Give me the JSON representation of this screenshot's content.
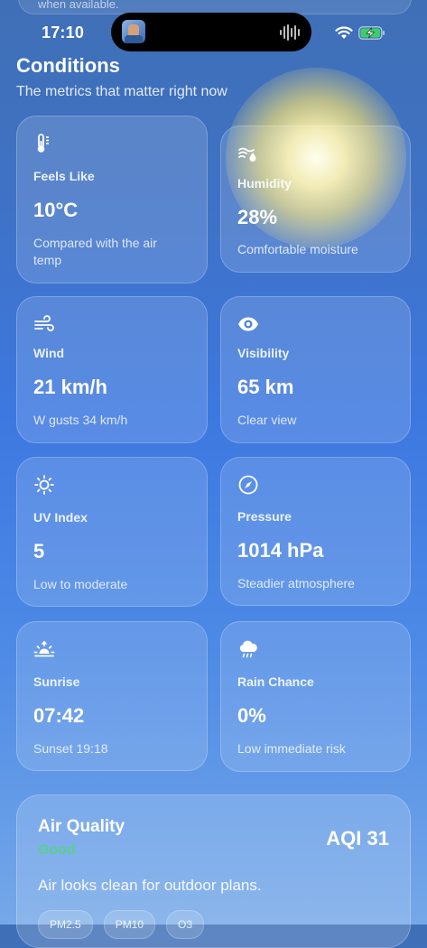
{
  "status_bar": {
    "time": "17:10",
    "cut_text": "when available."
  },
  "section": {
    "title": "Conditions",
    "subtitle": "The metrics that matter right now"
  },
  "metrics": [
    {
      "icon": "thermometer-icon",
      "label": "Feels Like",
      "value": "10°C",
      "note": "Compared with the air temp"
    },
    {
      "icon": "humidity-icon",
      "label": "Humidity",
      "value": "28%",
      "note": "Comfortable moisture"
    },
    {
      "icon": "wind-icon",
      "label": "Wind",
      "value": "21 km/h",
      "note": "W gusts 34 km/h"
    },
    {
      "icon": "eye-icon",
      "label": "Visibility",
      "value": "65 km",
      "note": "Clear view"
    },
    {
      "icon": "sun-icon",
      "label": "UV Index",
      "value": "5",
      "note": "Low to moderate"
    },
    {
      "icon": "compass-icon",
      "label": "Pressure",
      "value": "1014 hPa",
      "note": "Steadier atmosphere"
    },
    {
      "icon": "sunrise-icon",
      "label": "Sunrise",
      "value": "07:42",
      "note": "Sunset 19:18"
    },
    {
      "icon": "rain-cloud-icon",
      "label": "Rain Chance",
      "value": "0%",
      "note": "Low immediate risk"
    }
  ],
  "air_quality": {
    "title": "Air Quality",
    "status": "Good",
    "index": "AQI 31",
    "description": "Air looks clean for outdoor plans.",
    "pills": [
      "PM2.5",
      "PM10",
      "O3"
    ],
    "status_color": "#58d08d"
  }
}
